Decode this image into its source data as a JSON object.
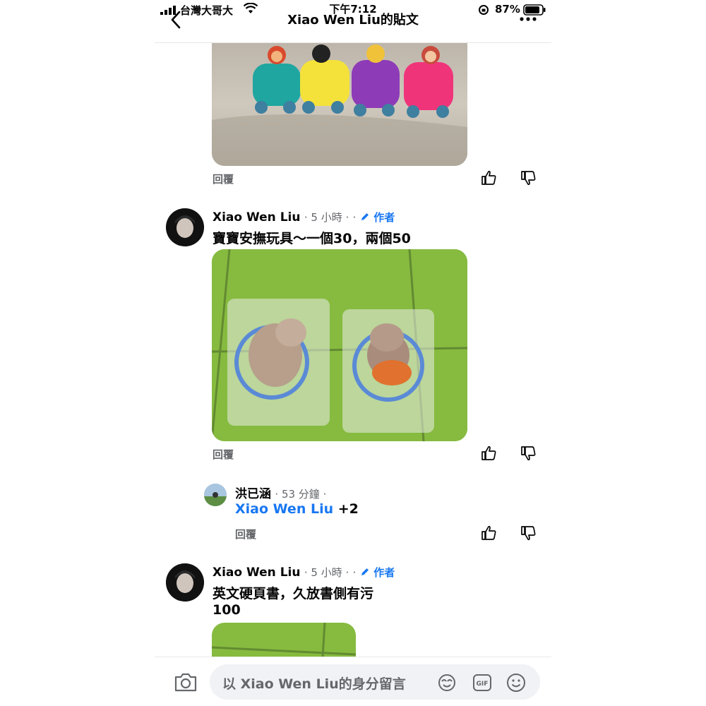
{
  "status_bar": {
    "carrier": "台灣大哥大",
    "time": "下午7:12",
    "battery_percent": "87%"
  },
  "header": {
    "title": "Xiao Wen Liu的貼文"
  },
  "comments": [
    {
      "reply_label": "回覆"
    },
    {
      "author": "Xiao Wen Liu",
      "time": "· 5 小時 ·",
      "dot": "·",
      "author_badge": "作者",
      "text": "寶寶安撫玩具～一個30，兩個50",
      "reply_label": "回覆"
    },
    {
      "author": "洪已涵",
      "time": "· 53 分鐘 ·",
      "mention": "Xiao Wen Liu",
      "text_suffix": " +2",
      "reply_label": "回覆"
    },
    {
      "author": "Xiao Wen Liu",
      "time": "· 5 小時 ·",
      "dot": "·",
      "author_badge": "作者",
      "text_line1": "英文硬頁書，久放書側有污",
      "text_line2": "100"
    }
  ],
  "composer": {
    "placeholder": "以 Xiao Wen Liu的身分留言"
  },
  "icons": [
    "camera-icon",
    "avatar-sticker-icon",
    "gif-icon",
    "emoji-icon",
    "like-icon",
    "dislike-icon",
    "pencil-icon",
    "back-icon",
    "wifi-icon",
    "battery-icon"
  ],
  "colors": {
    "accent": "#1877f2",
    "muted": "#65676b"
  }
}
